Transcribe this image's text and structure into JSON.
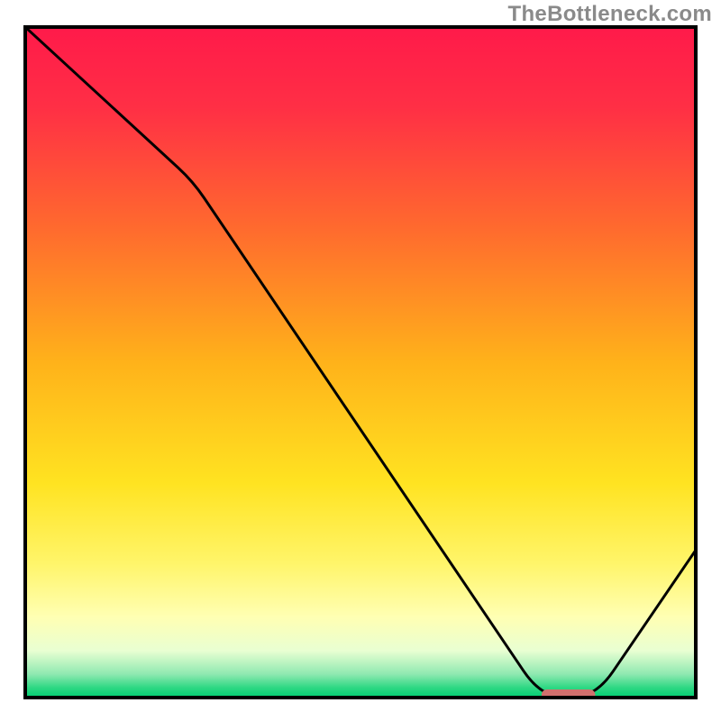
{
  "watermark": "TheBottleneck.com",
  "chart_data": {
    "type": "line",
    "title": "",
    "xlabel": "",
    "ylabel": "",
    "xlim": [
      0,
      100
    ],
    "ylim": [
      0,
      100
    ],
    "x": [
      0,
      25,
      77,
      85,
      100
    ],
    "values": [
      100,
      77,
      0,
      0,
      22
    ],
    "marker": {
      "x_start": 77,
      "x_end": 85,
      "y": 0,
      "color": "#d2706e"
    },
    "gradient_stops": [
      {
        "offset": 0.0,
        "color": "#ff1a4a"
      },
      {
        "offset": 0.12,
        "color": "#ff2f45"
      },
      {
        "offset": 0.3,
        "color": "#ff6a2e"
      },
      {
        "offset": 0.5,
        "color": "#ffb21a"
      },
      {
        "offset": 0.68,
        "color": "#ffe321"
      },
      {
        "offset": 0.8,
        "color": "#fff56a"
      },
      {
        "offset": 0.88,
        "color": "#ffffb3"
      },
      {
        "offset": 0.93,
        "color": "#e9ffd2"
      },
      {
        "offset": 0.965,
        "color": "#8fe9b1"
      },
      {
        "offset": 0.985,
        "color": "#2fd884"
      },
      {
        "offset": 1.0,
        "color": "#00cf72"
      }
    ],
    "frame": {
      "stroke": "#000000",
      "stroke_width": 4
    },
    "curve": {
      "stroke": "#000000",
      "stroke_width": 3
    }
  }
}
